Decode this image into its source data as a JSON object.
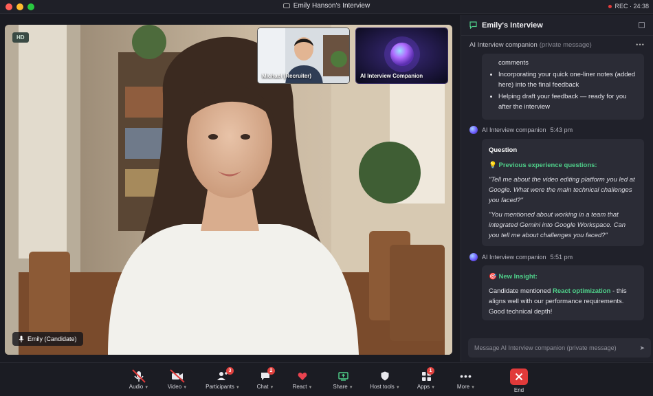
{
  "window": {
    "title": "Emily Hanson's Interview",
    "rec_label": "REC · 24:38"
  },
  "colors": {
    "accent_green": "#4fd08a",
    "end_red": "#e13a3a",
    "badge_red": "#e0423f"
  },
  "video": {
    "hd_badge": "HD",
    "main_participant": "Emily (Candidate)",
    "tiles": [
      {
        "label": "Michael (Recruiter)"
      },
      {
        "label": "AI Interview Companion"
      }
    ]
  },
  "panel": {
    "title": "Emily's Interview",
    "subheader_name": "AI Interview companion",
    "subheader_note": "(private message)",
    "card1": {
      "lead": "comments",
      "bullets": [
        "Incorporating your quick one-liner notes (added here) into the final feedback",
        "Helping draft your feedback — ready for you after the interview"
      ]
    },
    "msg2": {
      "sender": "AI Interview companion",
      "time": "5:43 pm"
    },
    "card2": {
      "title": "Question",
      "section": "Previous experience questions:",
      "q1": "\"Tell me about the video editing platform you led at Google. What were the main technical challenges you faced?\"",
      "q2": "\"You mentioned about working in a team that integrated Gemini into Google Workspace. Can you tell me about challenges you faced?\""
    },
    "msg3": {
      "sender": "AI Interview companion",
      "time": "5:51 pm"
    },
    "card3": {
      "title": "New Insight:",
      "text_before": "Candidate mentioned ",
      "highlight": "React optimization",
      "text_after": " - this aligns well with our performance requirements. Good technical depth!"
    },
    "input_placeholder": "Message AI Interview companion (private message)"
  },
  "toolbar": {
    "audio": "Audio",
    "video": "Video",
    "participants": "Participants",
    "participants_badge": "3",
    "chat": "Chat",
    "chat_badge": "2",
    "react": "React",
    "share": "Share",
    "host_tools": "Host tools",
    "apps": "Apps",
    "apps_badge": "1",
    "more": "More",
    "end": "End"
  }
}
